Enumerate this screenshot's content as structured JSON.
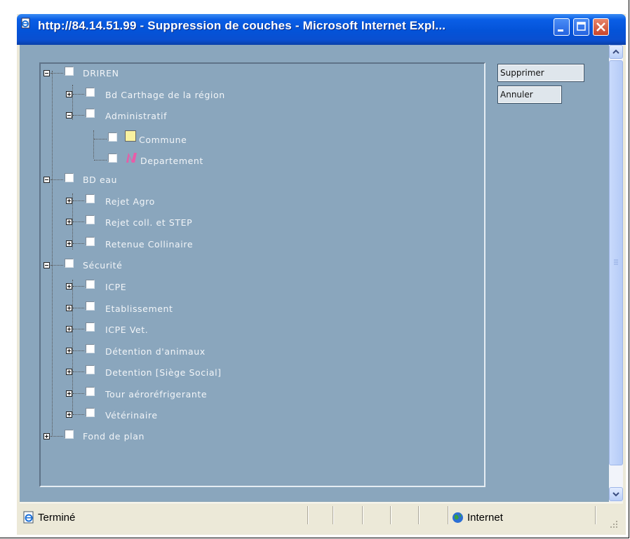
{
  "window": {
    "title": "http://84.14.51.99 - Suppression de couches - Microsoft Internet Expl..."
  },
  "tree": {
    "nodes": [
      {
        "label": "DRIREN"
      },
      {
        "label": "Bd Carthage de la région"
      },
      {
        "label": "Administratif"
      },
      {
        "label": "Commune"
      },
      {
        "label": "Departement"
      },
      {
        "label": "BD eau"
      },
      {
        "label": "Rejet Agro"
      },
      {
        "label": "Rejet coll. et STEP"
      },
      {
        "label": "Retenue Collinaire"
      },
      {
        "label": "Sécurité"
      },
      {
        "label": "ICPE"
      },
      {
        "label": "Etablissement"
      },
      {
        "label": "ICPE Vet."
      },
      {
        "label": "Détention d'animaux"
      },
      {
        "label": "Detention [Siège Social]"
      },
      {
        "label": "Tour aéroréfrigerante"
      },
      {
        "label": "Vétérinaire"
      },
      {
        "label": "Fond de plan"
      }
    ]
  },
  "actions": {
    "delete_label": "Supprimer",
    "cancel_label": "Annuler"
  },
  "status": {
    "text": "Terminé",
    "zone": "Internet"
  },
  "colors": {
    "background": "#8aa6bd",
    "titlebar": "#0453d8",
    "legend_commune": "#f8f1a0",
    "legend_departement": "#e85ca8"
  },
  "icons": {
    "page": "ie-page-icon",
    "minimize": "minimize-icon",
    "maximize": "maximize-icon",
    "close": "close-icon",
    "legend_commune": "yellow-square-legend-icon",
    "legend_departement": "pink-n-legend-icon",
    "globe": "globe-icon"
  }
}
